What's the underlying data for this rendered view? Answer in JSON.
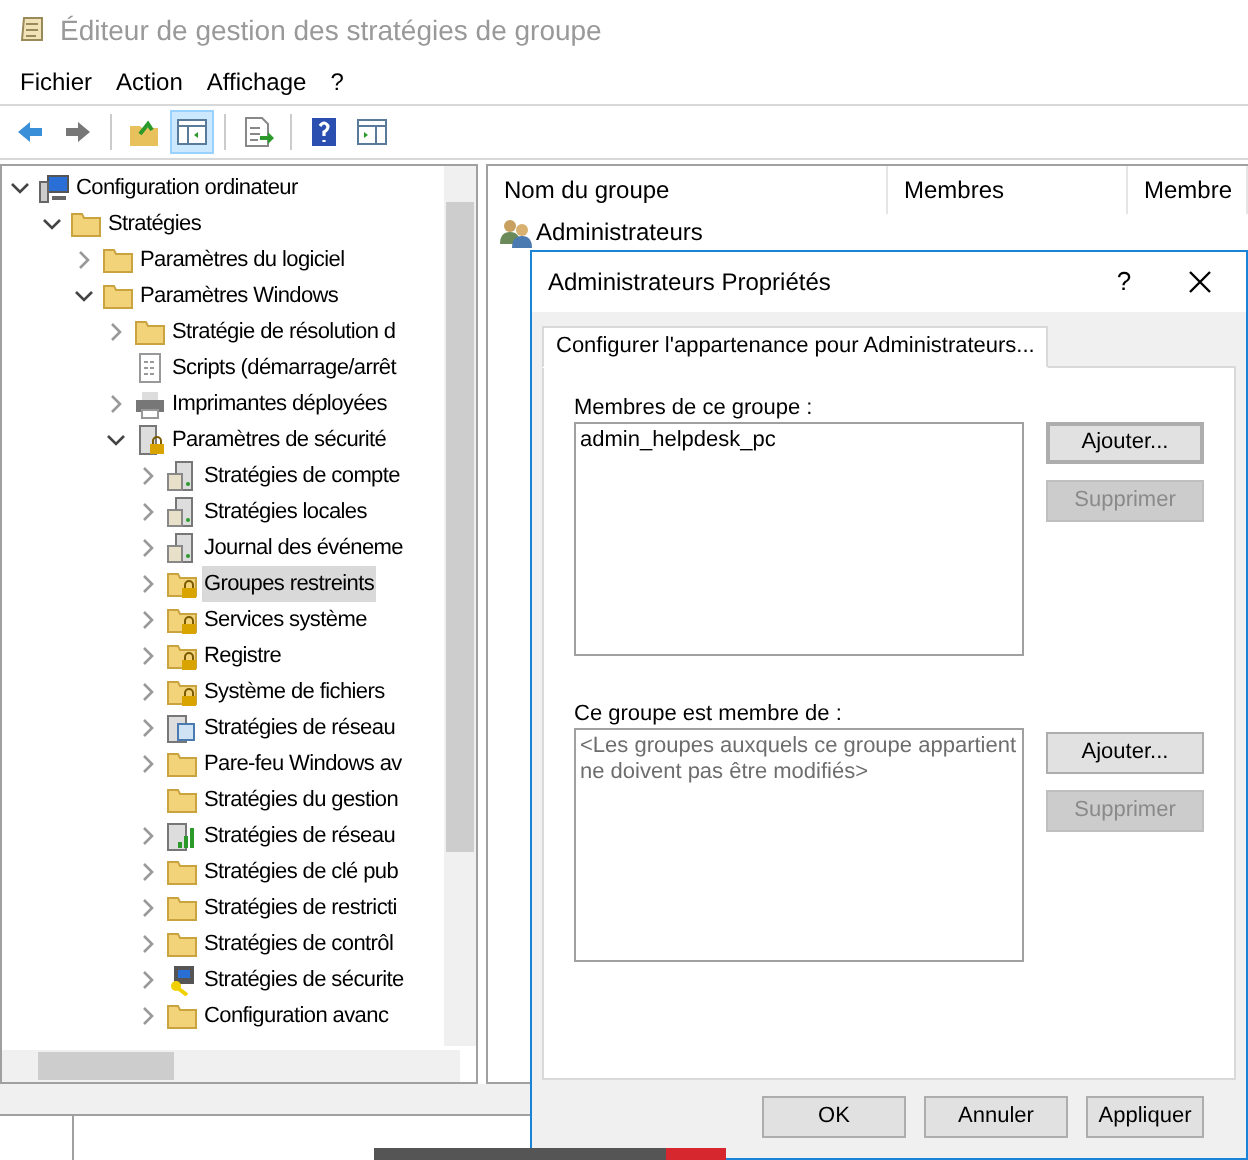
{
  "window": {
    "title": "Éditeur de gestion des stratégies de groupe"
  },
  "menu": [
    "Fichier",
    "Action",
    "Affichage",
    "?"
  ],
  "toolbar": [
    {
      "kind": "back",
      "selected": false
    },
    {
      "kind": "forward",
      "selected": false
    },
    {
      "kind": "up",
      "selected": false
    },
    {
      "kind": "pane",
      "selected": true
    },
    {
      "kind": "export",
      "selected": false
    },
    {
      "kind": "help",
      "selected": false
    },
    {
      "kind": "view",
      "selected": false
    }
  ],
  "tree": [
    {
      "label": "Configuration ordinateur",
      "kind": "computer",
      "expandable": true,
      "expanded": true,
      "selected": false,
      "children": [
        {
          "label": "Stratégies",
          "kind": "folder",
          "expandable": true,
          "expanded": true,
          "selected": false,
          "children": [
            {
              "label": "Paramètres du logiciel",
              "kind": "folder",
              "expandable": true,
              "expanded": false,
              "selected": false
            },
            {
              "label": "Paramètres Windows",
              "kind": "folder",
              "expandable": true,
              "expanded": true,
              "selected": false,
              "children": [
                {
                  "label": "Stratégie de résolution d",
                  "kind": "folder",
                  "expandable": true,
                  "expanded": false,
                  "selected": false
                },
                {
                  "label": "Scripts (démarrage/arrêt",
                  "kind": "script",
                  "expandable": false,
                  "selected": false
                },
                {
                  "label": "Imprimantes déployées",
                  "kind": "printer",
                  "expandable": true,
                  "expanded": false,
                  "selected": false
                },
                {
                  "label": "Paramètres de sécurité",
                  "kind": "server-lock",
                  "expandable": true,
                  "expanded": true,
                  "selected": false,
                  "children": [
                    {
                      "label": "Stratégies de compte",
                      "kind": "server",
                      "expandable": true,
                      "expanded": false,
                      "selected": false
                    },
                    {
                      "label": "Stratégies locales",
                      "kind": "server",
                      "expandable": true,
                      "expanded": false,
                      "selected": false
                    },
                    {
                      "label": "Journal des événeme",
                      "kind": "server",
                      "expandable": true,
                      "expanded": false,
                      "selected": false
                    },
                    {
                      "label": "Groupes restreints",
                      "kind": "folder-lock",
                      "expandable": true,
                      "expanded": false,
                      "selected": true
                    },
                    {
                      "label": "Services système",
                      "kind": "folder-lock",
                      "expandable": true,
                      "expanded": false,
                      "selected": false
                    },
                    {
                      "label": "Registre",
                      "kind": "folder-lock",
                      "expandable": true,
                      "expanded": false,
                      "selected": false
                    },
                    {
                      "label": "Système de fichiers",
                      "kind": "folder-lock",
                      "expandable": true,
                      "expanded": false,
                      "selected": false
                    },
                    {
                      "label": "Stratégies de réseau",
                      "kind": "network",
                      "expandable": true,
                      "expanded": false,
                      "selected": false
                    },
                    {
                      "label": "Pare-feu Windows av",
                      "kind": "folder",
                      "expandable": true,
                      "expanded": false,
                      "selected": false
                    },
                    {
                      "label": "Stratégies du gestion",
                      "kind": "folder",
                      "expandable": false,
                      "selected": false
                    },
                    {
                      "label": "Stratégies de réseau",
                      "kind": "chart",
                      "expandable": true,
                      "expanded": false,
                      "selected": false
                    },
                    {
                      "label": "Stratégies de clé pub",
                      "kind": "folder",
                      "expandable": true,
                      "expanded": false,
                      "selected": false
                    },
                    {
                      "label": "Stratégies de restricti",
                      "kind": "folder",
                      "expandable": true,
                      "expanded": false,
                      "selected": false
                    },
                    {
                      "label": "Stratégies de contrôl",
                      "kind": "folder",
                      "expandable": true,
                      "expanded": false,
                      "selected": false
                    },
                    {
                      "label": "Stratégies de sécurite",
                      "kind": "key-computer",
                      "expandable": true,
                      "expanded": false,
                      "selected": false
                    },
                    {
                      "label": "Configuration avanc",
                      "kind": "folder",
                      "expandable": true,
                      "expanded": false,
                      "selected": false
                    }
                  ]
                }
              ]
            }
          ]
        }
      ]
    }
  ],
  "table": {
    "columns": [
      "Nom du groupe",
      "Membres",
      "Membre"
    ],
    "rows": [
      {
        "name": "Administrateurs"
      }
    ]
  },
  "dialog": {
    "title": "Administrateurs Propriétés",
    "help": "?",
    "tabs": [
      {
        "label": "Configurer l'appartenance pour Administrateurs...",
        "selected": true
      }
    ],
    "sections": [
      {
        "label": "Membres de ce groupe :",
        "items": [
          "admin_helpdesk_pc"
        ],
        "buttons": [
          {
            "label": "Ajouter...",
            "disabled": false,
            "focused": true
          },
          {
            "label": "Supprimer",
            "disabled": true,
            "focused": false
          }
        ]
      },
      {
        "label": "Ce groupe est membre de :",
        "placeholder": "<Les groupes auxquels ce groupe appartient ne doivent pas être modifiés>",
        "buttons": [
          {
            "label": "Ajouter...",
            "disabled": false,
            "focused": false
          },
          {
            "label": "Supprimer",
            "disabled": true,
            "focused": false
          }
        ]
      }
    ],
    "buttons": [
      "OK",
      "Annuler",
      "Appliquer"
    ]
  }
}
